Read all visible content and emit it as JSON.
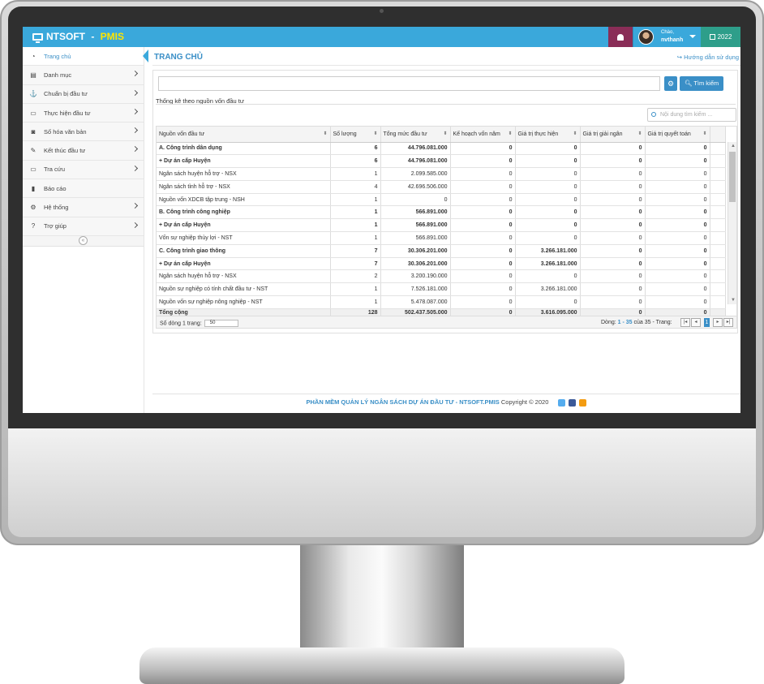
{
  "app": {
    "brand": "NTSOFT",
    "brand_sep": " - ",
    "brand_suffix": "PMIS",
    "greeting": "Chào,",
    "username": "nvthanh",
    "year": "2022"
  },
  "sidebar": {
    "items": [
      {
        "label": "Trang chủ",
        "icon": "dashboard-icon"
      },
      {
        "label": "Danh mục",
        "icon": "book-icon"
      },
      {
        "label": "Chuẩn bị đầu tư",
        "icon": "anchor-icon"
      },
      {
        "label": "Thực hiện đầu tư",
        "icon": "laptop-icon"
      },
      {
        "label": "Số hóa văn bản",
        "icon": "android-icon"
      },
      {
        "label": "Kết thúc đầu tư",
        "icon": "gavel-icon"
      },
      {
        "label": "Tra cứu",
        "icon": "laptop-icon"
      },
      {
        "label": "Báo cáo",
        "icon": "file-icon"
      },
      {
        "label": "Hệ thống",
        "icon": "gears-icon"
      },
      {
        "label": "Trợ giúp",
        "icon": "question-icon"
      }
    ]
  },
  "main": {
    "title": "TRANG CHỦ",
    "guide": "Hướng dẫn sử dụng",
    "search_button": "Tìm kiếm",
    "section": "Thống kê theo nguồn vốn đầu tư",
    "filter_placeholder": "Nội dung tìm kiếm ..."
  },
  "table": {
    "columns": [
      "Nguồn vốn đầu tư",
      "Số lượng",
      "Tổng mức đầu tư",
      "Kế hoạch vốn năm",
      "Giá trị thực hiện",
      "Giá trị giải ngân",
      "Giá trị quyết toán"
    ],
    "rows": [
      {
        "bold": true,
        "c": [
          "A. Công trình dân dụng",
          "6",
          "44.796.081.000",
          "0",
          "0",
          "0",
          "0"
        ]
      },
      {
        "bold": true,
        "c": [
          "+ Dự án cấp Huyện",
          "6",
          "44.796.081.000",
          "0",
          "0",
          "0",
          "0"
        ]
      },
      {
        "bold": false,
        "c": [
          "Ngân sách huyện hỗ trợ - NSX",
          "1",
          "2.099.585.000",
          "0",
          "0",
          "0",
          "0"
        ]
      },
      {
        "bold": false,
        "c": [
          "Ngân sách tỉnh hỗ trợ - NSX",
          "4",
          "42.696.506.000",
          "0",
          "0",
          "0",
          "0"
        ]
      },
      {
        "bold": false,
        "c": [
          "Nguồn vốn XDCB tập trung - NSH",
          "1",
          "0",
          "0",
          "0",
          "0",
          "0"
        ]
      },
      {
        "bold": true,
        "c": [
          "B. Công trình công nghiệp",
          "1",
          "566.891.000",
          "0",
          "0",
          "0",
          "0"
        ]
      },
      {
        "bold": true,
        "c": [
          "+ Dự án cấp Huyện",
          "1",
          "566.891.000",
          "0",
          "0",
          "0",
          "0"
        ]
      },
      {
        "bold": false,
        "c": [
          "Vốn sự nghiệp thủy lợi - NST",
          "1",
          "566.891.000",
          "0",
          "0",
          "0",
          "0"
        ]
      },
      {
        "bold": true,
        "c": [
          "C. Công trình giao thông",
          "7",
          "30.306.201.000",
          "0",
          "3.266.181.000",
          "0",
          "0"
        ]
      },
      {
        "bold": true,
        "c": [
          "+ Dự án cấp Huyện",
          "7",
          "30.306.201.000",
          "0",
          "3.266.181.000",
          "0",
          "0"
        ]
      },
      {
        "bold": false,
        "c": [
          "Ngân sách huyện hỗ trợ - NSX",
          "2",
          "3.200.190.000",
          "0",
          "0",
          "0",
          "0"
        ]
      },
      {
        "bold": false,
        "c": [
          "Nguồn sự nghiệp có tính chất đầu tư - NST",
          "1",
          "7.526.181.000",
          "0",
          "3.266.181.000",
          "0",
          "0"
        ]
      },
      {
        "bold": false,
        "c": [
          "Nguồn vốn sự nghiệp nông nghiệp - NST",
          "1",
          "5.478.087.000",
          "0",
          "0",
          "0",
          "0"
        ]
      }
    ],
    "total": [
      "Tổng cộng",
      "128",
      "502.437.505.000",
      "0",
      "3.616.095.000",
      "0",
      "0"
    ]
  },
  "pager": {
    "rows_label": "Số dòng 1 trang:",
    "rows_value": "50",
    "info_prefix": "Dòng:",
    "info_range": "1 - 35",
    "info_mid": "của 35 - Trang:",
    "page": "1"
  },
  "footer": {
    "brand": "PHẦN MỀM QUẢN LÝ NGÂN SÁCH DỰ ÁN ĐẦU TƯ - NTSOFT.PMIS",
    "copy": "Copyright © 2020"
  },
  "colors": {
    "topbar": "#3aa8db",
    "bell": "#8a2d57",
    "year": "#2e9e8a",
    "accent": "#3a8fc7"
  }
}
